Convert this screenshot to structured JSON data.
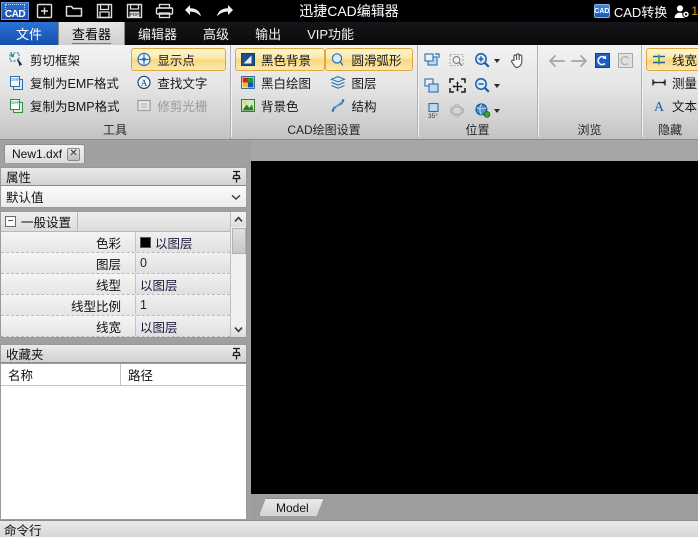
{
  "app": {
    "title": "迅捷CAD编辑器",
    "logo": "CAD"
  },
  "quick_access": {
    "items": [
      {
        "name": "new-icon",
        "label": "新建"
      },
      {
        "name": "open-icon",
        "label": "打开"
      },
      {
        "name": "save-icon",
        "label": "保存"
      },
      {
        "name": "save-pdf-icon",
        "label": "另存为PDF"
      },
      {
        "name": "print-icon",
        "label": "打印"
      },
      {
        "name": "undo-icon",
        "label": "撤销"
      },
      {
        "name": "redo-icon",
        "label": "重做"
      }
    ]
  },
  "titlebar_right": {
    "convert_label": "CAD转换",
    "convert_icon_text": "CAD",
    "user_count": "1"
  },
  "tabs": [
    {
      "label": "文件",
      "state": "file"
    },
    {
      "label": "查看器",
      "state": "active"
    },
    {
      "label": "编辑器",
      "state": "normal"
    },
    {
      "label": "高级",
      "state": "normal"
    },
    {
      "label": "输出",
      "state": "normal"
    },
    {
      "label": "VIP功能",
      "state": "normal"
    }
  ],
  "ribbon": {
    "groups": [
      {
        "title": "工具",
        "col1": [
          {
            "label": "剪切框架",
            "icon": "crop-frame-icon",
            "state": "normal"
          },
          {
            "label": "复制为EMF格式",
            "icon": "copy-emf-icon",
            "state": "normal"
          },
          {
            "label": "复制为BMP格式",
            "icon": "copy-bmp-icon",
            "state": "normal"
          }
        ],
        "col2": [
          {
            "label": "显示点",
            "icon": "show-points-icon",
            "state": "highlighted"
          },
          {
            "label": "查找文字",
            "icon": "find-text-icon",
            "state": "normal"
          },
          {
            "label": "修剪光栅",
            "icon": "trim-raster-icon",
            "state": "disabled"
          }
        ]
      },
      {
        "title": "CAD绘图设置",
        "col1": [
          {
            "label": "黑色背景",
            "icon": "black-background-icon",
            "state": "highlighted"
          },
          {
            "label": "黑白绘图",
            "icon": "monochrome-draw-icon",
            "state": "normal"
          },
          {
            "label": "背景色",
            "icon": "background-color-icon",
            "state": "normal"
          }
        ],
        "col2": [
          {
            "label": "圆滑弧形",
            "icon": "smooth-arc-icon",
            "state": "highlighted"
          },
          {
            "label": "图层",
            "icon": "layers-icon",
            "state": "normal"
          },
          {
            "label": "结构",
            "icon": "structure-icon",
            "state": "normal"
          }
        ]
      },
      {
        "title": "位置",
        "icon_grid": [
          [
            {
              "name": "zoom-window-icon",
              "state": "normal",
              "caret": false
            },
            {
              "name": "zoom-select-icon",
              "state": "disabled",
              "caret": false
            },
            {
              "name": "zoom-in-icon",
              "state": "normal",
              "caret": true
            },
            {
              "name": "pan-hand-icon",
              "state": "normal",
              "caret": false
            }
          ],
          [
            {
              "name": "zoom-previous-icon",
              "state": "normal",
              "caret": false
            },
            {
              "name": "zoom-extents-icon",
              "state": "normal",
              "caret": false
            },
            {
              "name": "zoom-out-icon",
              "state": "normal",
              "caret": true
            },
            {
              "name": "spacer",
              "state": "empty",
              "caret": false
            }
          ],
          [
            {
              "name": "rotate-35-icon",
              "state": "normal",
              "caret": false
            },
            {
              "name": "orbit-icon",
              "state": "disabled",
              "caret": false
            },
            {
              "name": "view-style-icon",
              "state": "normal",
              "caret": true
            },
            {
              "name": "spacer",
              "state": "empty",
              "caret": false
            }
          ]
        ]
      },
      {
        "title": "浏览",
        "icon_grid": [
          [
            {
              "name": "back-arrow-icon",
              "state": "disabled",
              "caret": false
            },
            {
              "name": "forward-arrow-icon",
              "state": "disabled",
              "caret": false
            },
            {
              "name": "refresh-icon",
              "state": "normal",
              "caret": false
            },
            {
              "name": "reload-view-icon",
              "state": "disabled",
              "caret": false
            }
          ]
        ]
      },
      {
        "title": "隐藏",
        "col1": [
          {
            "label": "线宽",
            "icon": "line-width-icon",
            "state": "highlighted"
          },
          {
            "label": "测量",
            "icon": "measure-icon",
            "state": "normal"
          },
          {
            "label": "文本",
            "icon": "text-icon",
            "state": "normal"
          }
        ]
      }
    ]
  },
  "document_tab": {
    "name": "New1.dxf",
    "close": "✕"
  },
  "properties_panel": {
    "title": "属性",
    "selector_value": "默认值",
    "group_label": "一般设置",
    "group_expander": "−",
    "rows": [
      {
        "key": "色彩",
        "value": "以图层",
        "swatch": "#000000"
      },
      {
        "key": "图层",
        "value": "0",
        "swatch": null
      },
      {
        "key": "线型",
        "value": "以图层",
        "swatch": null
      },
      {
        "key": "线型比例",
        "value": "1",
        "swatch": null
      },
      {
        "key": "线宽",
        "value": "以图层",
        "swatch": null
      }
    ]
  },
  "favorites_panel": {
    "title": "收藏夹",
    "columns": [
      "名称",
      "路径"
    ],
    "rows": []
  },
  "canvas": {
    "background": "#000000",
    "model_tab": "Model"
  },
  "command_line": {
    "label": "命令行"
  }
}
